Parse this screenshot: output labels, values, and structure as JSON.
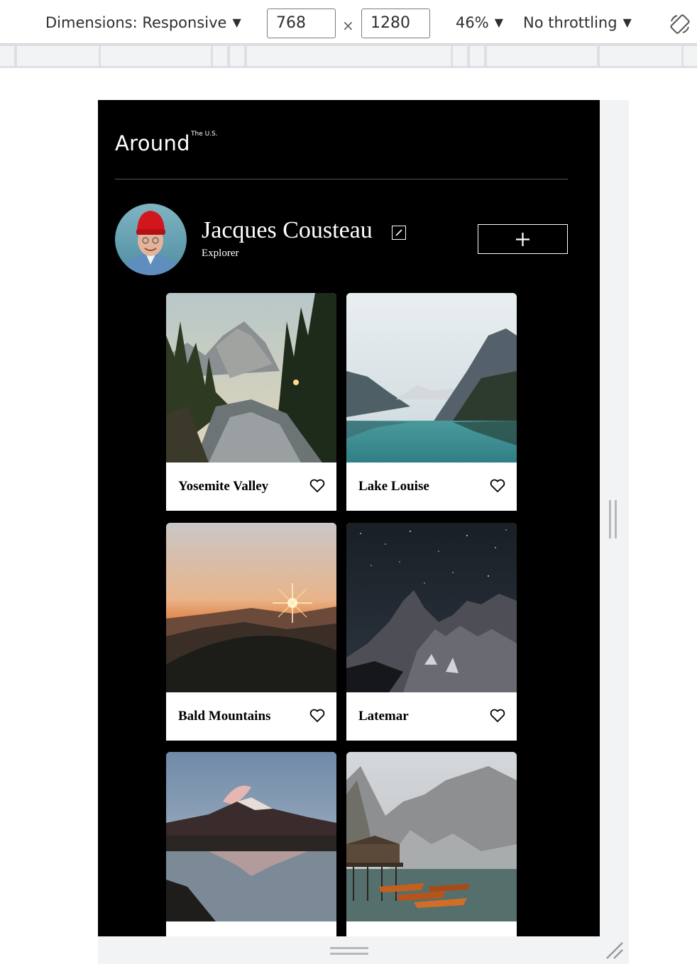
{
  "devtools": {
    "dimensions_label": "Dimensions: Responsive",
    "width_value": "768",
    "times_symbol": "×",
    "height_value": "1280",
    "zoom_label": "46%",
    "throttling_label": "No throttling",
    "caret": "▼"
  },
  "header": {
    "logo": "Around",
    "logo_sub": "The U.S."
  },
  "profile": {
    "name": "Jacques Cousteau",
    "job": "Explorer"
  },
  "cards": [
    {
      "title": "Yosemite Valley"
    },
    {
      "title": "Lake Louise"
    },
    {
      "title": "Bald Mountains"
    },
    {
      "title": "Latemar"
    },
    {
      "title": ""
    },
    {
      "title": ""
    }
  ],
  "colors": {
    "page_background": "#000000",
    "card_background": "#ffffff",
    "text_on_dark": "#ffffff",
    "avatar_hat": "#d2161e"
  }
}
